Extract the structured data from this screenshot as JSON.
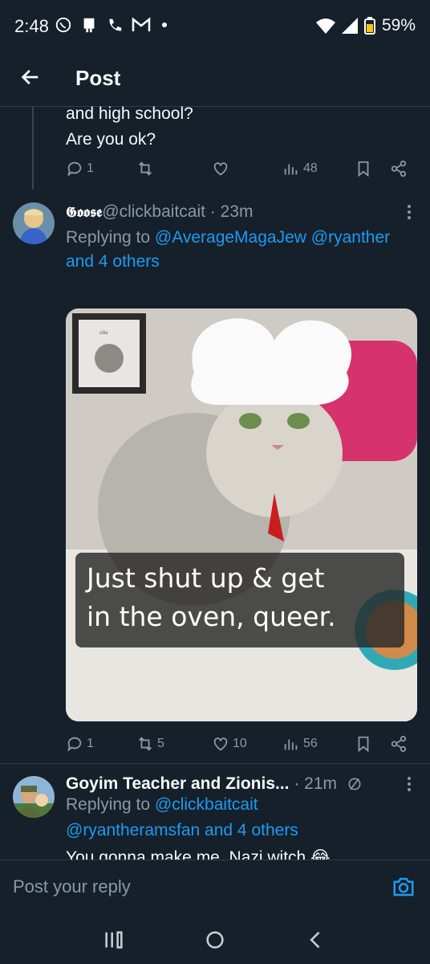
{
  "status": {
    "time": "2:48",
    "battery": "59%",
    "left_icons": [
      "whatsapp-icon",
      "notification-icon",
      "phone-icon",
      "gmail-icon",
      "dot-icon"
    ],
    "right_icons": [
      "wifi-icon",
      "signal-icon",
      "battery-icon"
    ]
  },
  "header": {
    "title": "Post"
  },
  "prev_post": {
    "text_line1": "and high school?",
    "text_line2": "Are you ok?",
    "actions": {
      "replies": "1",
      "reposts": "",
      "likes": "",
      "views": "48"
    }
  },
  "post": {
    "display_name": "𝕲𝖔𝖔𝖘𝖊",
    "handle": "@clickbaitcait",
    "time": "· 23m",
    "replying_prefix": "Replying to ",
    "replying_users": "@AverageMagaJew @ryanther",
    "replying_others": "and 4 others",
    "image_caption_line1": "Just shut up & get",
    "image_caption_line2": "in the oven, queer.",
    "frame_label": "ollie",
    "actions": {
      "replies": "1",
      "reposts": "5",
      "likes": "10",
      "views": "56"
    }
  },
  "reply": {
    "display_name": "Goyim Teacher and Zionis...",
    "time": "· 21m",
    "replying_prefix": "Replying to ",
    "replying_user1": "@clickbaitcait",
    "replying_user2": "@ryantheramsfan and 4 others",
    "text": "You gonna make me, Nazi witch 😂"
  },
  "composer": {
    "placeholder": "Post your reply"
  },
  "colors": {
    "background": "#15202b",
    "accent": "#1d9bf0",
    "muted": "#8b98a5",
    "text": "#f7f9f9"
  }
}
